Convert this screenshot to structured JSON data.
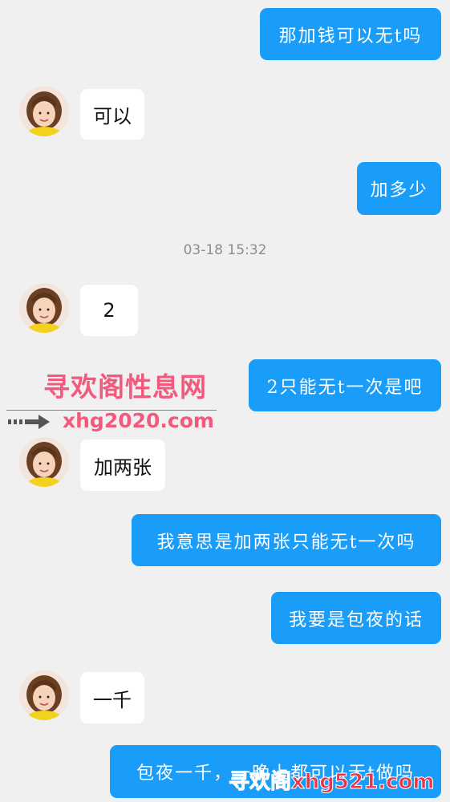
{
  "messages": [
    {
      "id": "m1",
      "side": "out",
      "text": "那加钱可以无t吗"
    },
    {
      "id": "m2",
      "side": "in",
      "text": "可以"
    },
    {
      "id": "m3",
      "side": "out",
      "text": "加多少"
    },
    {
      "id": "m4",
      "side": "in",
      "text": "2"
    },
    {
      "id": "m5",
      "side": "out",
      "text": "2只能无t一次是吧"
    },
    {
      "id": "m6",
      "side": "in",
      "text": "加两张"
    },
    {
      "id": "m7",
      "side": "out",
      "text": "我意思是加两张只能无t一次吗"
    },
    {
      "id": "m8",
      "side": "out",
      "text": "我要是包夜的话"
    },
    {
      "id": "m9",
      "side": "in",
      "text": "一千"
    },
    {
      "id": "m10",
      "side": "out",
      "text": "包夜一千，一晚上都可以无t做吗"
    }
  ],
  "timestamp": "03-18 15:32",
  "watermark": {
    "site_name": "寻欢阁性息网",
    "site_url": "xhg2020.com",
    "bottom_text": "寻欢阁xhg521.com"
  },
  "colors": {
    "background": "#f0f0f0",
    "outgoing_bubble": "#1a9df8",
    "incoming_bubble": "#ffffff",
    "watermark": "#f2597d"
  },
  "icons": {
    "avatar": "contact-avatar-photo",
    "arrow": "dashed-right-arrow-icon"
  }
}
